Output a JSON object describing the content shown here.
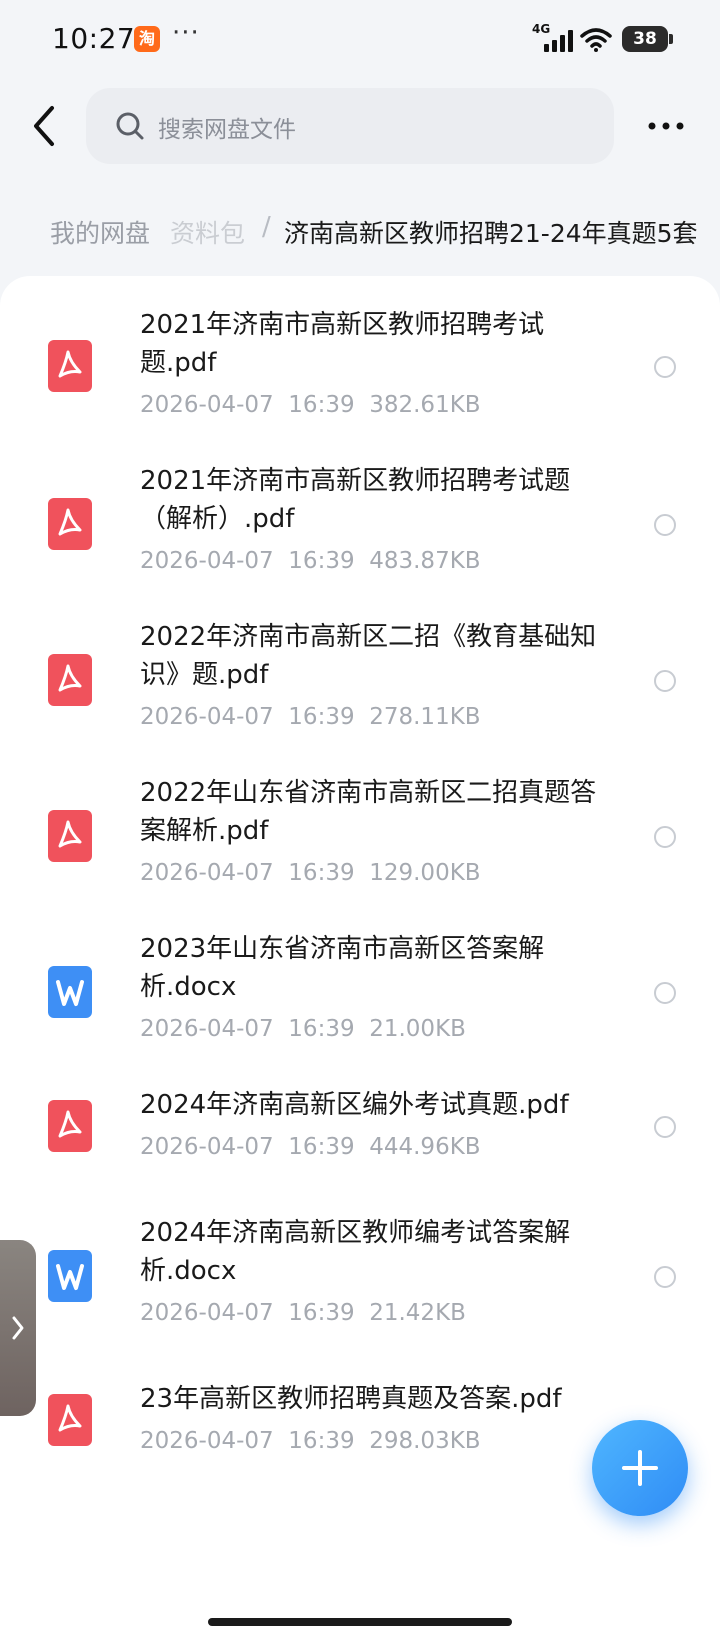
{
  "status_bar": {
    "time": "10:27",
    "app_badge": "淘",
    "dots": "···",
    "network": "4G",
    "battery": "38"
  },
  "header": {
    "search_placeholder": "搜索网盘文件"
  },
  "breadcrumb": {
    "root": "我的网盘",
    "middle": "资料包",
    "separator": "/",
    "current": "济南高新区教师招聘21-24年真题5套"
  },
  "files": [
    {
      "name": "2021年济南市高新区教师招聘考试题.pdf",
      "type": "pdf",
      "date": "2026-04-07",
      "time": "16:39",
      "size": "382.61KB"
    },
    {
      "name": "2021年济南市高新区教师招聘考试题（解析）.pdf",
      "type": "pdf",
      "date": "2026-04-07",
      "time": "16:39",
      "size": "483.87KB"
    },
    {
      "name": "2022年济南市高新区二招《教育基础知识》题.pdf",
      "type": "pdf",
      "date": "2026-04-07",
      "time": "16:39",
      "size": "278.11KB"
    },
    {
      "name": "2022年山东省济南市高新区二招真题答案解析.pdf",
      "type": "pdf",
      "date": "2026-04-07",
      "time": "16:39",
      "size": "129.00KB"
    },
    {
      "name": "2023年山东省济南市高新区答案解析.docx",
      "type": "doc",
      "date": "2026-04-07",
      "time": "16:39",
      "size": "21.00KB"
    },
    {
      "name": "2024年济南高新区编外考试真题.pdf",
      "type": "pdf",
      "date": "2026-04-07",
      "time": "16:39",
      "size": "444.96KB"
    },
    {
      "name": "2024年济南高新区教师编考试答案解析.docx",
      "type": "doc",
      "date": "2026-04-07",
      "time": "16:39",
      "size": "21.42KB"
    },
    {
      "name": "23年高新区教师招聘真题及答案.pdf",
      "type": "pdf",
      "date": "2026-04-07",
      "time": "16:39",
      "size": "298.03KB"
    }
  ],
  "colors": {
    "pdf_icon": "#f0525c",
    "doc_icon": "#3e8ff5",
    "fab": "#2f8cf5",
    "meta_text": "#a5a9b0"
  },
  "icons": {
    "pdf": "pdf-file-icon",
    "doc": "word-file-icon"
  }
}
